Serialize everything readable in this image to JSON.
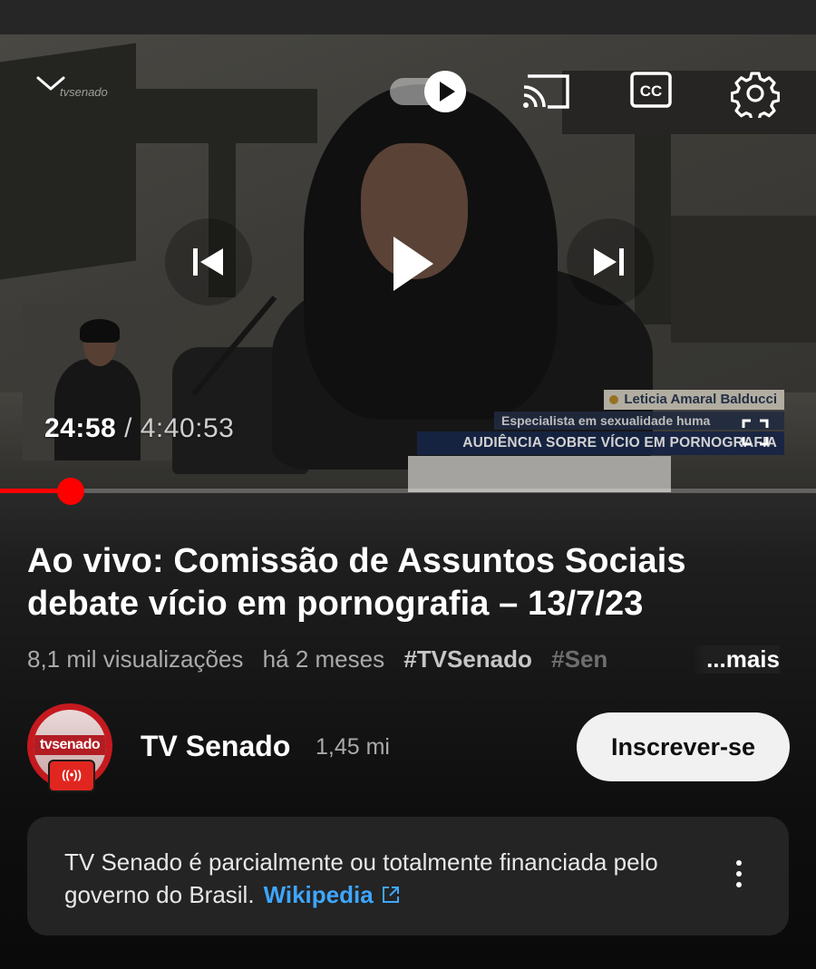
{
  "player": {
    "watermark": "tvsenado",
    "current_time": "24:58",
    "separator": " / ",
    "duration": "4:40:53",
    "progress_fraction": 0.087,
    "lower_third": {
      "name": "Leticia Amaral Balducci",
      "role": "Especialista em sexualidade huma",
      "title": "AUDIÊNCIA SOBRE VÍCIO EM PORNOGRAFIA"
    },
    "icons": [
      "chevron-down-icon",
      "autoplay-toggle-icon",
      "cast-icon",
      "cc-icon",
      "gear-icon",
      "previous-icon",
      "play-icon",
      "next-icon",
      "fullscreen-icon"
    ]
  },
  "video": {
    "title": "Ao vivo: Comissão de Assuntos Sociais debate vício em pornografia – 13/7/23",
    "views": "8,1 mil visualizações",
    "age": "há 2 meses",
    "hashtag1": "#TVSenado",
    "hashtag2": "#Sen",
    "more": "...mais"
  },
  "channel": {
    "avatar_text": "tvsenado",
    "live_badge": "((•))",
    "name": "TV Senado",
    "subscribers": "1,45 mi",
    "subscribe_label": "Inscrever-se"
  },
  "info_panel": {
    "text": "TV Senado é parcialmente ou totalmente financiada pelo governo do Brasil.",
    "link": "Wikipedia"
  },
  "colors": {
    "progress": "#ff0000",
    "link": "#3ea6ff",
    "subscribe_bg": "#f1f1f1"
  }
}
